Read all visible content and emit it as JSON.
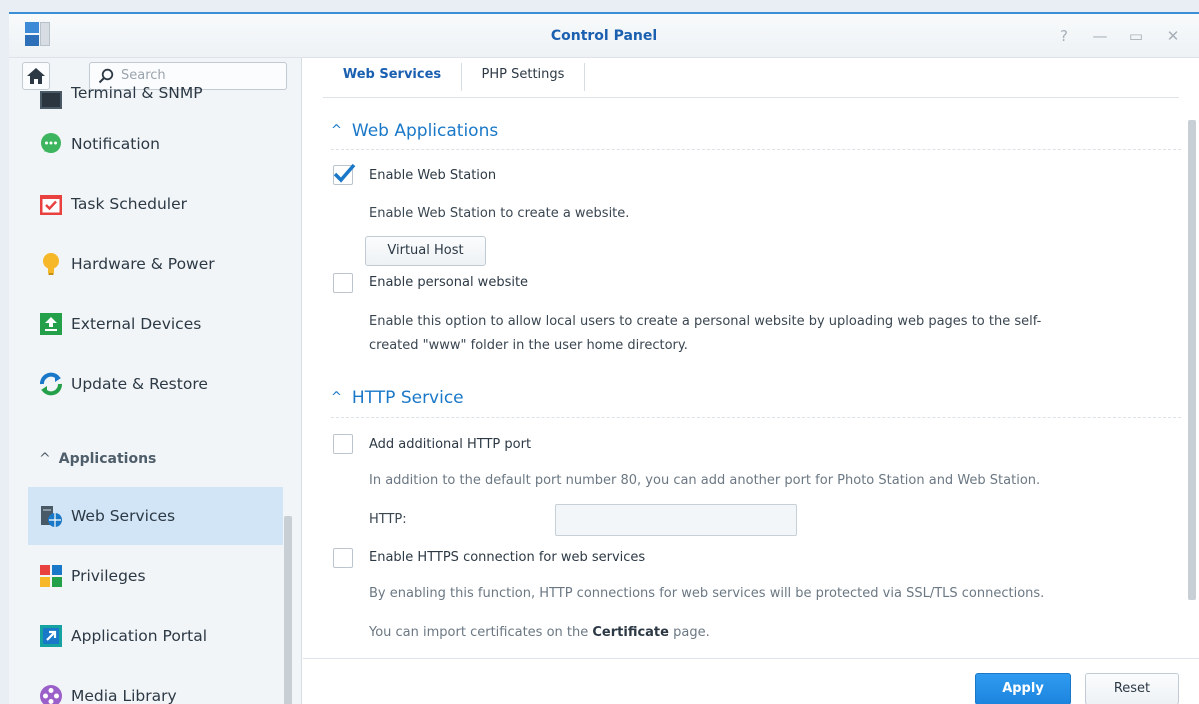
{
  "window": {
    "title": "Control Panel",
    "controls": {
      "help": "?",
      "minimize": "—",
      "maximize": "▭",
      "close": "✕"
    }
  },
  "sidebar": {
    "search_placeholder": "Search",
    "items": [
      {
        "label": "Terminal & SNMP",
        "icon": "terminal-icon"
      },
      {
        "label": "Notification",
        "icon": "chat-bubble-icon"
      },
      {
        "label": "Task Scheduler",
        "icon": "calendar-check-icon"
      },
      {
        "label": "Hardware & Power",
        "icon": "lightbulb-icon"
      },
      {
        "label": "External Devices",
        "icon": "upload-device-icon"
      },
      {
        "label": "Update & Restore",
        "icon": "refresh-icon"
      }
    ],
    "group_header": "Applications",
    "app_items": [
      {
        "label": "Web Services",
        "icon": "web-services-icon",
        "active": true
      },
      {
        "label": "Privileges",
        "icon": "privileges-grid-icon"
      },
      {
        "label": "Application Portal",
        "icon": "portal-arrow-icon"
      },
      {
        "label": "Media Library",
        "icon": "film-reel-icon"
      }
    ]
  },
  "tabs": [
    {
      "label": "Web Services",
      "active": true
    },
    {
      "label": "PHP Settings",
      "active": false
    }
  ],
  "web_applications": {
    "header": "Web Applications",
    "enable_web_station": {
      "label": "Enable Web Station",
      "checked": true
    },
    "web_station_desc": "Enable Web Station to create a website.",
    "virtual_host_button": "Virtual Host",
    "enable_personal": {
      "label": "Enable personal website",
      "checked": false
    },
    "personal_desc_line1": "Enable this option to allow local users to create a personal website by uploading web pages to the self-",
    "personal_desc_line2": "created \"www\" folder in the user home directory."
  },
  "http_service": {
    "header": "HTTP Service",
    "additional_port": {
      "label": "Add additional HTTP port",
      "checked": false
    },
    "additional_port_desc": "In addition to the default port number 80, you can add another port for Photo Station and Web Station.",
    "http_label": "HTTP:",
    "http_value": "",
    "enable_https": {
      "label": "Enable HTTPS connection for web services",
      "checked": false
    },
    "https_desc": "By enabling this function, HTTP connections for web services will be protected via SSL/TLS connections.",
    "cert_prefix": "You can import certificates on the ",
    "cert_link": "Certificate",
    "cert_suffix": " page."
  },
  "footer": {
    "apply": "Apply",
    "reset": "Reset"
  },
  "colors": {
    "accent": "#1a78c8",
    "active_item_bg": "#d2e5f6",
    "apply_bg": "#1d84de"
  }
}
